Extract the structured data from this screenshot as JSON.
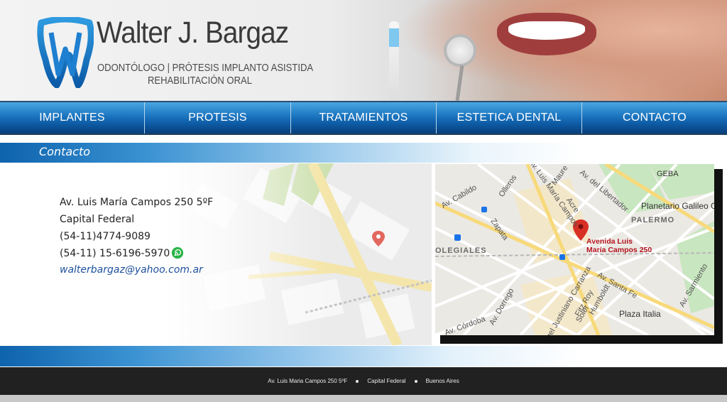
{
  "header": {
    "brand_name": "Walter J. Bargaz",
    "subtitle_line1": "ODONTÓLOGO | PRÓTESIS IMPLANTO ASISTIDA",
    "subtitle_line2": "REHABILITACIÓN ORAL",
    "logo_icon": "tooth-logo-icon"
  },
  "nav": {
    "items": [
      {
        "label": "IMPLANTES"
      },
      {
        "label": "PROTESIS"
      },
      {
        "label": "TRATAMIENTOS"
      },
      {
        "label": "ESTETICA DENTAL"
      },
      {
        "label": "CONTACTO"
      }
    ]
  },
  "section": {
    "title": "Contacto"
  },
  "contact": {
    "address": "Av. Luis María Campos 250 5ºF",
    "city": "Capital Federal",
    "phone": "(54-11)4774-9089",
    "mobile": "(54-11) 15-6196-5970",
    "email": "walterbargaz@yahoo.com.ar",
    "whatsapp_icon": "whatsapp-icon"
  },
  "map": {
    "pin_label_line1": "Avenida Luis",
    "pin_label_line2": "María Campos 250",
    "labels": {
      "geba": "GEBA",
      "planetario": "Planetario Galileo G",
      "palermo": "PALERMO",
      "colegiales": "OLEGIALES",
      "plaza_italia": "Plaza Italia",
      "av_cabildo": "Av. Cabildo",
      "olleros": "Olleros",
      "maure": "Maure",
      "av_luis": "Av. Luis María Campos",
      "acre": "Acre",
      "av_libertador": "Av. del Libertador",
      "zapata": "Zapata",
      "av_santa_fe": "Av. Santa Fe",
      "av_dorrego": "Av. Dorrego",
      "angel": "Angel Justiniano Carranza",
      "fitz_roy": "Fitz Roy",
      "humboldt": "Humboldt",
      "soler": "Soler",
      "av_sarmiento": "Av. Sarmiento",
      "av_cordoba": "Av. Córdoba"
    }
  },
  "footer": {
    "address": "Av. Luis Maria Campos 250 5ºF",
    "city": "Capital Federal",
    "region": "Buenos Aires"
  },
  "colors": {
    "nav_blue": "#1b74bf",
    "accent_blue": "#0e63ad",
    "email_blue": "#1d4f9c",
    "pin_red": "#d93025",
    "footer_bg": "#212121"
  }
}
